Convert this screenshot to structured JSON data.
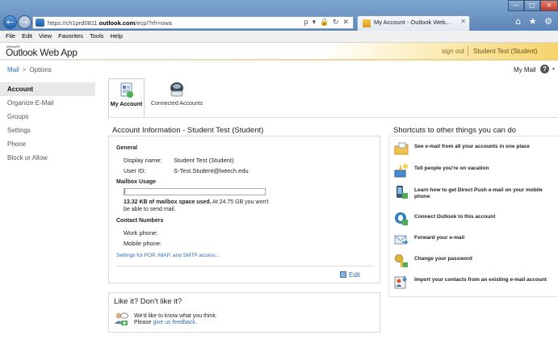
{
  "browser": {
    "url_prefix": "https://ch1prd0811.",
    "url_domain": "outlook.com",
    "url_suffix": "/ecp/?rfr=owa",
    "address_icons": "ρ ▾ 🔒 ↻ ✕",
    "tab_title": "My Account - Outlook Web...",
    "tab_close": "✕",
    "back_glyph": "←",
    "forward_glyph": "→",
    "min_glyph": "—",
    "max_glyph": "□",
    "close_glyph": "✕",
    "home_star_glyphs": "⌂ ★ ⚙"
  },
  "menubar": [
    "File",
    "Edit",
    "View",
    "Favorites",
    "Tools",
    "Help"
  ],
  "header": {
    "ms_label": "Microsoft®",
    "app_title": "Outlook Web App",
    "sign_out": "sign out",
    "user_name": "Student Test (Student)"
  },
  "breadcrumb": {
    "root": "Mail",
    "separator": ">",
    "current": "Options"
  },
  "top_right": {
    "mymail": "My Mail",
    "help": "?",
    "caret": "▾"
  },
  "leftnav": [
    "Account",
    "Organize E-Mail",
    "Groups",
    "Settings",
    "Phone",
    "Block or Allow"
  ],
  "tabs": {
    "my_account": "My Account",
    "connected_accounts": "Connected Accounts"
  },
  "account": {
    "title": "Account Information - Student Test (Student)",
    "general_heading": "General",
    "display_name_label": "Display name:",
    "display_name_value": "Student Test (Student)",
    "user_id_label": "User ID:",
    "user_id_value": "S-Test.Student@lwtech.edu",
    "mailbox_heading": "Mailbox Usage",
    "usage_fraction": 0.0005,
    "usage_bold": "13.32 KB of mailbox space used.",
    "usage_rest": " At 24.75 GB you won't be able to send mail.",
    "contact_heading": "Contact Numbers",
    "work_phone_label": "Work phone:",
    "mobile_phone_label": "Mobile phone:",
    "pop_link": "Settings for POP, IMAP, and SMTP access...",
    "edit_label": "Edit"
  },
  "feedback": {
    "title": "Like it? Don't like it?",
    "line1": "We'd like to know what you think.",
    "line2_prefix": "Please ",
    "line2_link": "give us feedback",
    "line2_suffix": "."
  },
  "shortcuts": {
    "title": "Shortcuts to other things you can do",
    "items": [
      {
        "label": "See e-mail from all your accounts in one place",
        "icon": "folder-mail-icon"
      },
      {
        "label": "Tell people you're on vacation",
        "icon": "vacation-icon"
      },
      {
        "label": "Learn how to get Direct Push e-mail on your mobile phone",
        "icon": "mobile-phone-icon"
      },
      {
        "label": "Connect Outlook to this account",
        "icon": "outlook-connect-icon"
      },
      {
        "label": "Forward your e-mail",
        "icon": "forward-mail-icon"
      },
      {
        "label": "Change your password",
        "icon": "password-key-icon"
      },
      {
        "label": "Import your contacts from an existing e-mail account",
        "icon": "import-contacts-icon"
      }
    ]
  },
  "colors": {
    "link": "#2e6db4",
    "header_gold": "#f6d36c",
    "active_nav": "#e8e8e8"
  }
}
